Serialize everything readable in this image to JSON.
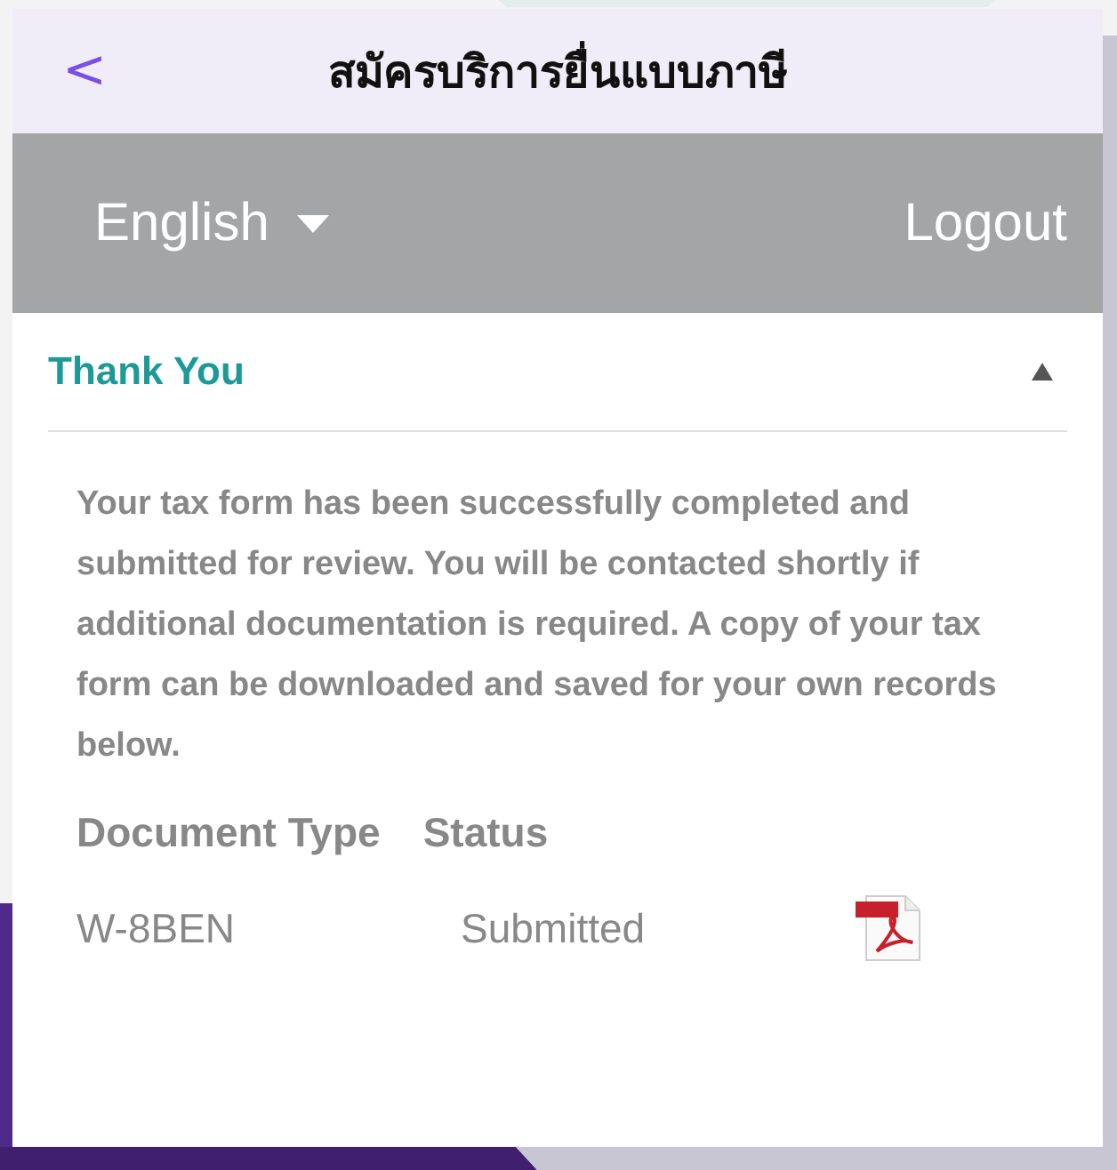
{
  "header": {
    "title": "สมัครบริการยื่นแบบภาษี",
    "back": "<"
  },
  "toolbar": {
    "language": "English",
    "logout": "Logout"
  },
  "section": {
    "title": "Thank You",
    "expanded": true,
    "message": "Your tax form has been successfully completed and submitted for review. You will be contacted shortly if additional documentation is required. A copy of your tax form can be downloaded and saved for your own records below.",
    "table": {
      "columns": [
        "Document Type",
        "Status"
      ],
      "rows": [
        {
          "document_type": "W-8BEN",
          "status": "Submitted"
        }
      ]
    }
  }
}
